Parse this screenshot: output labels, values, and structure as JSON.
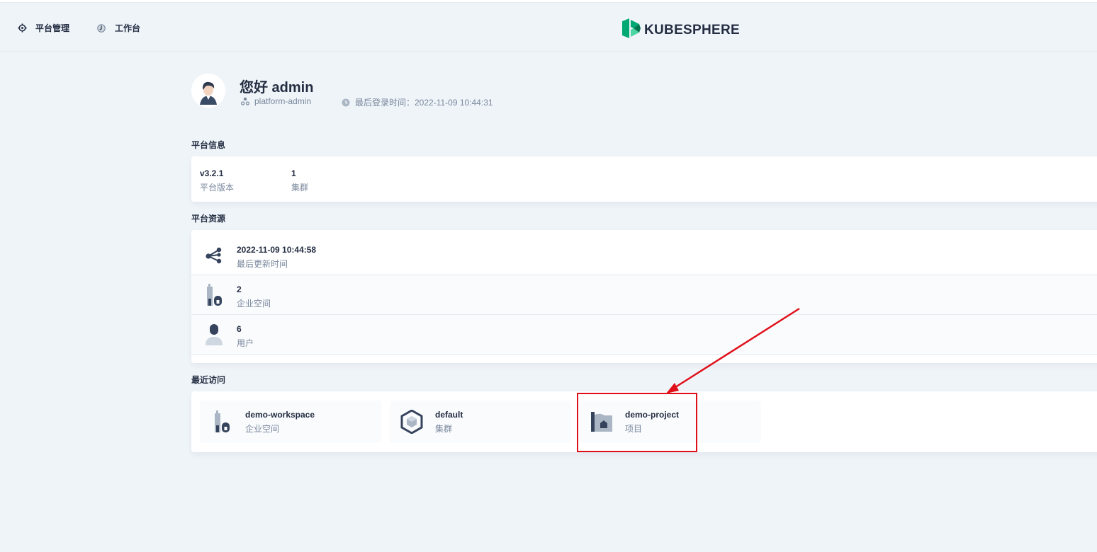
{
  "nav": {
    "platform_label": "平台管理",
    "workbench_label": "工作台"
  },
  "logo": {
    "brand": "KUBESPHERE"
  },
  "user": {
    "greeting": "您好 admin",
    "role": "platform-admin",
    "last_login": "最后登录时间：2022-11-09 10:44:31"
  },
  "platform_info": {
    "title": "平台信息",
    "items": [
      {
        "value": "v3.2.1",
        "label": "平台版本"
      },
      {
        "value": "1",
        "label": "集群"
      }
    ]
  },
  "platform_resources": {
    "title": "平台资源",
    "items": [
      {
        "value": "2022-11-09 10:44:58",
        "label": "最后更新时间",
        "icon": "share-nodes-icon"
      },
      {
        "value": "2",
        "label": "企业空间",
        "icon": "workspace-icon"
      },
      {
        "value": "6",
        "label": "用户",
        "icon": "user-icon"
      }
    ]
  },
  "recent": {
    "title": "最近访问",
    "items": [
      {
        "name": "demo-workspace",
        "type": "企业空间",
        "icon": "workspace-icon"
      },
      {
        "name": "default",
        "type": "集群",
        "icon": "cluster-icon"
      },
      {
        "name": "demo-project",
        "type": "项目",
        "icon": "project-icon"
      }
    ]
  },
  "annotation": {
    "color": "#e0101a"
  }
}
